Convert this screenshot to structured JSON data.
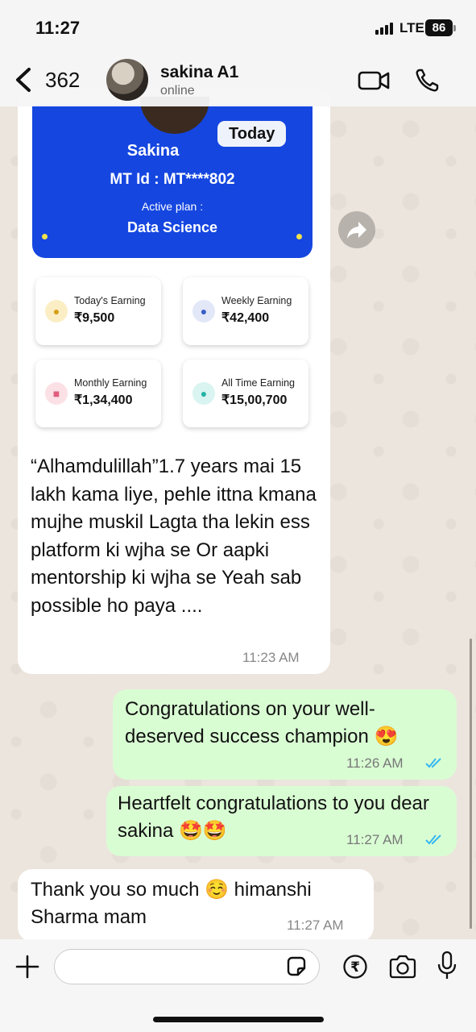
{
  "status_bar": {
    "time": "11:27",
    "network": "LTE",
    "battery": "86"
  },
  "header": {
    "back_count": "362",
    "contact_name": "sakina A1",
    "contact_status": "online"
  },
  "shared_image": {
    "badge": "Today",
    "name": "Sakina",
    "mt_id": "MT Id :  MT****802",
    "plan_label": "Active plan :",
    "plan": "Data Science",
    "stats": [
      {
        "label": "Today's Earning",
        "value": "₹9,500",
        "icon": "money-bag-icon",
        "color": "#fbeec4"
      },
      {
        "label": "Weekly Earning",
        "value": "₹42,400",
        "icon": "hand-coin-icon",
        "color": "#e2e8f8"
      },
      {
        "label": "Monthly Earning",
        "value": "₹1,34,400",
        "icon": "calendar-icon",
        "color": "#fbe1e6"
      },
      {
        "label": "All Time Earning",
        "value": "₹15,00,700",
        "icon": "piggy-bank-icon",
        "color": "#d9f4f1"
      }
    ]
  },
  "messages": [
    {
      "direction": "incoming",
      "text": "“Alhamdulillah”1.7 years mai 15 lakh kama liye, pehle ittna kmana mujhe muskil Lagta tha lekin ess platform ki wjha se    Or aapki mentorship ki wjha se Yeah sab possible ho paya ....",
      "time": "11:23 AM"
    },
    {
      "direction": "outgoing",
      "text": "Congratulations on your well-deserved success champion 😍",
      "time": "11:26 AM"
    },
    {
      "direction": "outgoing",
      "text": "Heartfelt congratulations to you dear sakina 🤩🤩",
      "time": "11:27 AM"
    },
    {
      "direction": "incoming",
      "text": "Thank you so much ☺️ himanshi Sharma mam",
      "time": "11:27 AM"
    }
  ],
  "input": {
    "placeholder": ""
  },
  "colors": {
    "outgoing_bubble": "#d9fdd3",
    "card_blue": "#1546e0",
    "read_ticks": "#34b7f1"
  }
}
